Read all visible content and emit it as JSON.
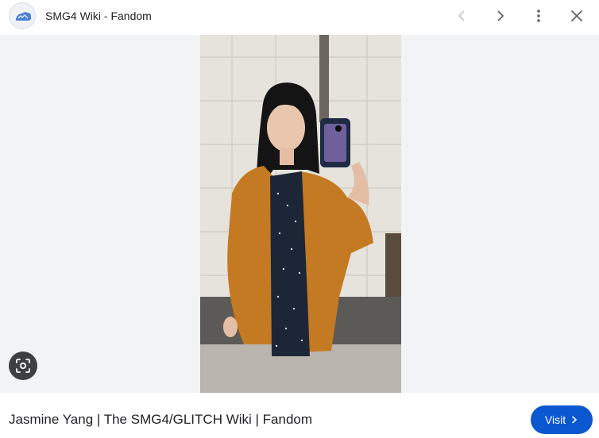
{
  "header": {
    "site_name": "SMG4 Wiki - Fandom",
    "logo_icon": "fandom-logo-icon",
    "prev_icon": "chevron-left-icon",
    "next_icon": "chevron-right-icon",
    "more_icon": "more-vert-icon",
    "close_icon": "close-icon"
  },
  "viewer": {
    "image_subject": "mirror selfie of a woman in orange cardigan",
    "lens_icon": "google-lens-icon"
  },
  "footer": {
    "caption": "Jasmine Yang | The SMG4/GLITCH Wiki | Fandom",
    "visit_label": "Visit",
    "visit_icon": "chevron-right-icon"
  },
  "colors": {
    "accent": "#0b57d0",
    "viewer_bg": "#f1f3f4",
    "icon_gray": "#5f6368"
  }
}
